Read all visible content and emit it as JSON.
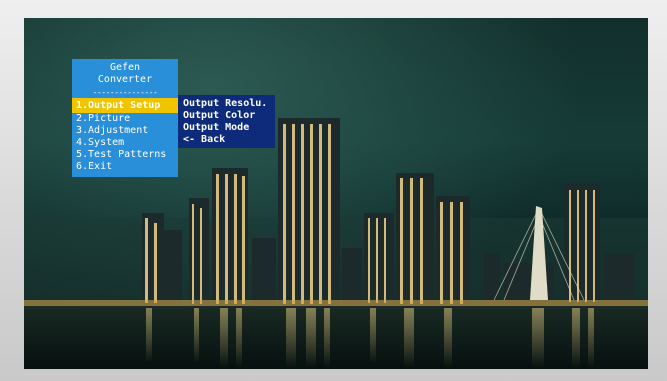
{
  "osd": {
    "title_line1": "Gefen",
    "title_line2": "Converter",
    "separator": "---------------",
    "menu_items": [
      {
        "label": "1.Output Setup",
        "selected": true
      },
      {
        "label": "2.Picture",
        "selected": false
      },
      {
        "label": "3.Adjustment",
        "selected": false
      },
      {
        "label": "4.System",
        "selected": false
      },
      {
        "label": "5.Test Patterns",
        "selected": false
      },
      {
        "label": "6.Exit",
        "selected": false
      }
    ]
  },
  "submenu": {
    "items": [
      {
        "label": "Output Resolu."
      },
      {
        "label": "Output Color"
      },
      {
        "label": "Output Mode"
      },
      {
        "label": "<- Back"
      }
    ]
  },
  "colors": {
    "menu_bg": "#2a8fd9",
    "menu_selected_bg": "#f1c400",
    "submenu_bg": "#0d2b7a",
    "menu_text": "#ffffff"
  }
}
